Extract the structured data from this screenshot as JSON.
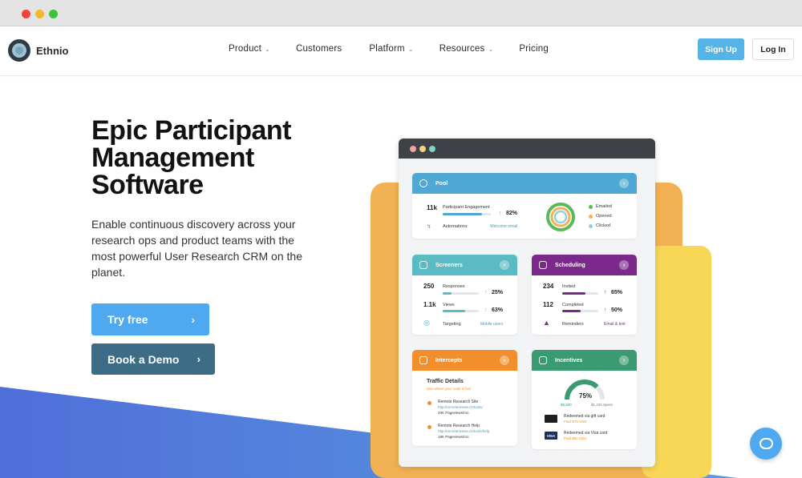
{
  "brand": {
    "name": "Ethnio"
  },
  "nav": {
    "items": [
      {
        "label": "Product",
        "has_menu": true
      },
      {
        "label": "Customers",
        "has_menu": false
      },
      {
        "label": "Platform",
        "has_menu": true
      },
      {
        "label": "Resources",
        "has_menu": true
      },
      {
        "label": "Pricing",
        "has_menu": false
      }
    ],
    "signup_label": "Sign Up",
    "login_label": "Log In"
  },
  "hero": {
    "title_lines": [
      "Epic Participant",
      "Management",
      "Software"
    ],
    "subtitle": "Enable continuous discovery across your research ops and product teams with the most powerful User Research CRM on the planet.",
    "try_label": "Try free",
    "demo_label": "Book a Demo"
  },
  "app": {
    "pool": {
      "title": "Pool",
      "engagement_count": "11k",
      "engagement_label": "Participant Engagement",
      "engagement_pct": "82%",
      "engagement_fill": 0.82,
      "automations_label": "Automations",
      "automations_link": "Welcome email",
      "legend": [
        "Emailed",
        "Opened",
        "Clicked"
      ]
    },
    "screeners": {
      "title": "Screeners",
      "responses_count": "250",
      "responses_label": "Responses",
      "responses_pct": "25%",
      "responses_fill": 0.25,
      "views_count": "1.1k",
      "views_label": "Views",
      "views_pct": "63%",
      "views_fill": 0.63,
      "targeting_label": "Targeting",
      "targeting_link": "Mobile users"
    },
    "scheduling": {
      "title": "Scheduling",
      "invited_count": "234",
      "invited_label": "Invited",
      "invited_pct": "65%",
      "invited_fill": 0.65,
      "completed_count": "112",
      "completed_label": "Completed",
      "completed_pct": "50%",
      "completed_fill": 0.5,
      "reminders_label": "Reminders",
      "reminders_link": "Email & text"
    },
    "intercepts": {
      "title": "Intercepts",
      "heading": "Traffic Details",
      "subheading": "See where your code is live",
      "sites": [
        {
          "name": "Remote Research Site",
          "url": "http://remoteresear.ch/tools/",
          "views": "20K Pageviews/mo"
        },
        {
          "name": "Remote Research Help",
          "url": "http://remoteresear.ch/tools/help",
          "views": "18K Pageviews/mo"
        }
      ]
    },
    "incentives": {
      "title": "Incentives",
      "gauge_pct": "75%",
      "gauge_fill": 0.75,
      "gauge_min": "$5,500",
      "gauge_spent": "$1,425 Spent",
      "items": [
        {
          "label": "Redeemed via gift card",
          "amount": "Paid $75 USD"
        },
        {
          "label": "Redeemed via Visa card",
          "amount": "Paid $50 USD"
        }
      ],
      "visa_text": "VISA"
    }
  },
  "colors": {
    "pool": "#4ea8d3",
    "screeners": "#5bbbc4",
    "scheduling": "#7b2a8c",
    "intercepts": "#f28f2c",
    "incentives": "#3a9a72",
    "try": "#4ea9f0",
    "demo": "#3d6d86"
  }
}
